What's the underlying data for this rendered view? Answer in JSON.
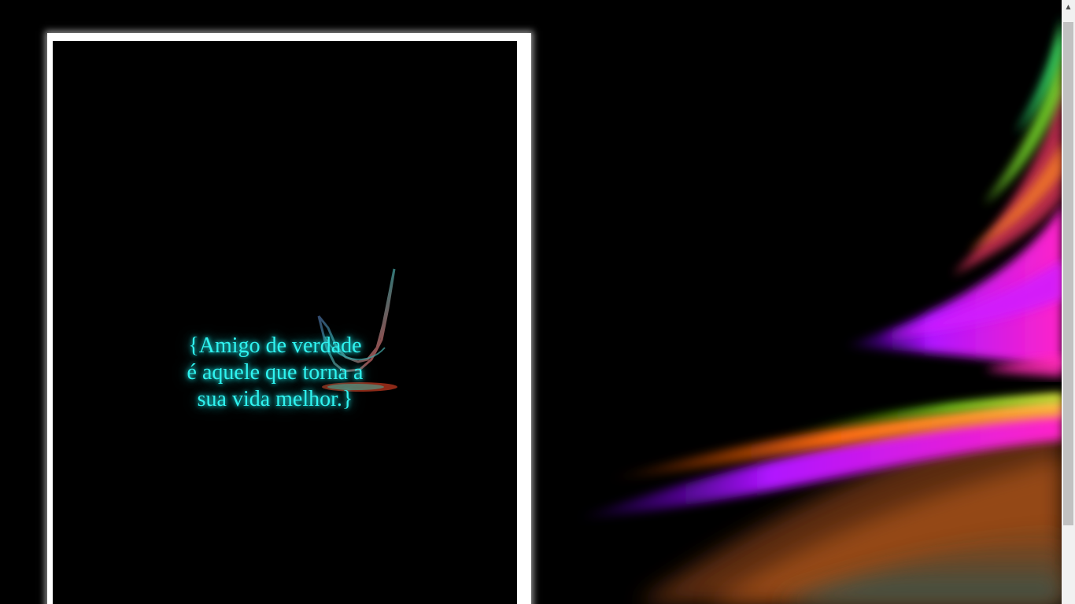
{
  "quote": {
    "text": "{Amigo de verdade\né aquele que torna a\nsua vida melhor.}"
  },
  "colors": {
    "background": "#000000",
    "frame": "#ffffff",
    "quote_text": "#2ff3f0",
    "streak_magenta": "#ff1fd2",
    "streak_orange": "#ff7a1a",
    "streak_green": "#7cff2a",
    "streak_purple": "#9b1cff"
  },
  "scrollbar": {
    "up_icon": "triangle-up-icon"
  }
}
